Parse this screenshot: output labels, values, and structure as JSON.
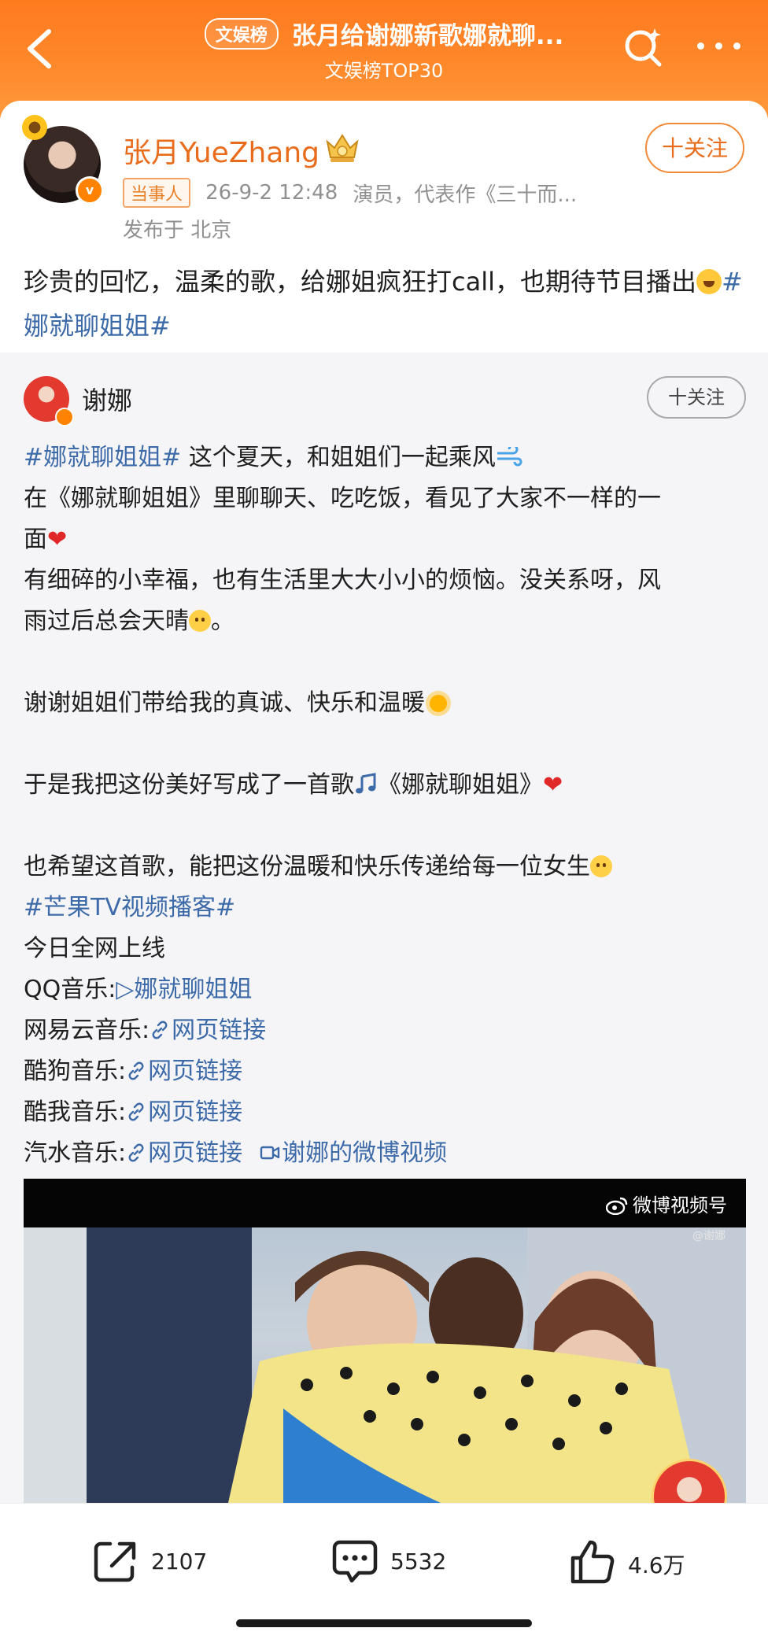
{
  "header": {
    "rank_badge": "文娱榜",
    "title": "张月给谢娜新歌娜就聊...",
    "subtitle": "文娱榜TOP30",
    "back_icon": "chevron-left-icon",
    "search_icon": "search-sparkle-icon",
    "more_icon": "more-dots-icon"
  },
  "post": {
    "author": "张月YueZhang",
    "follow_label": "十关注",
    "tag": "当事人",
    "time": "26-9-2 12:48",
    "desc": "演员，代表作《三十而...",
    "location": "发布于 北京",
    "text": "珍贵的回忆，温柔的歌，给娜姐疯狂打call，也期待节目播出",
    "hashtag": "#娜就聊姐姐#"
  },
  "repost": {
    "author": "谢娜",
    "follow_label": "十关注",
    "lines": {
      "l1_tag": "#娜就聊姐姐#",
      "l1_text": " 这个夏天，和姐姐们一起乘风",
      "l2": "在《娜就聊姐姐》里聊聊天、吃吃饭，看见了大家不一样的一",
      "l3": "面",
      "l4": "有细碎的小幸福，也有生活里大大小小的烦恼。没关系呀，风",
      "l5": "雨过后总会天晴",
      "l5_end": "。",
      "l7": "谢谢姐姐们带给我的真诚、快乐和温暖",
      "l9": "于是我把这份美好写成了一首歌",
      "l9_song": "《娜就聊姐姐》",
      "l11": "也希望这首歌，能把这份温暖和快乐传递给每一位女生",
      "l12_tag": "#芒果TV视频播客#",
      "l13": "今日全网上线",
      "qq_label": "QQ音乐:",
      "qq_link": "▷娜就聊姐姐",
      "netease_label": "网易云音乐:",
      "kugou_label": "酷狗音乐:",
      "kuwo_label": "酷我音乐:",
      "qishui_label": "汽水音乐:",
      "web_link": "网页链接",
      "video_link": "谢娜的微博视频"
    },
    "heart": "❤"
  },
  "video": {
    "watermark": "微博视频号",
    "handle": "@谢娜"
  },
  "actions": {
    "share_count": "2107",
    "comment_count": "5532",
    "like_count": "4.6万"
  },
  "colors": {
    "brand_orange": "#ff7a1e",
    "link_blue": "#3d6aa8",
    "name_orange": "#e86c1b"
  }
}
